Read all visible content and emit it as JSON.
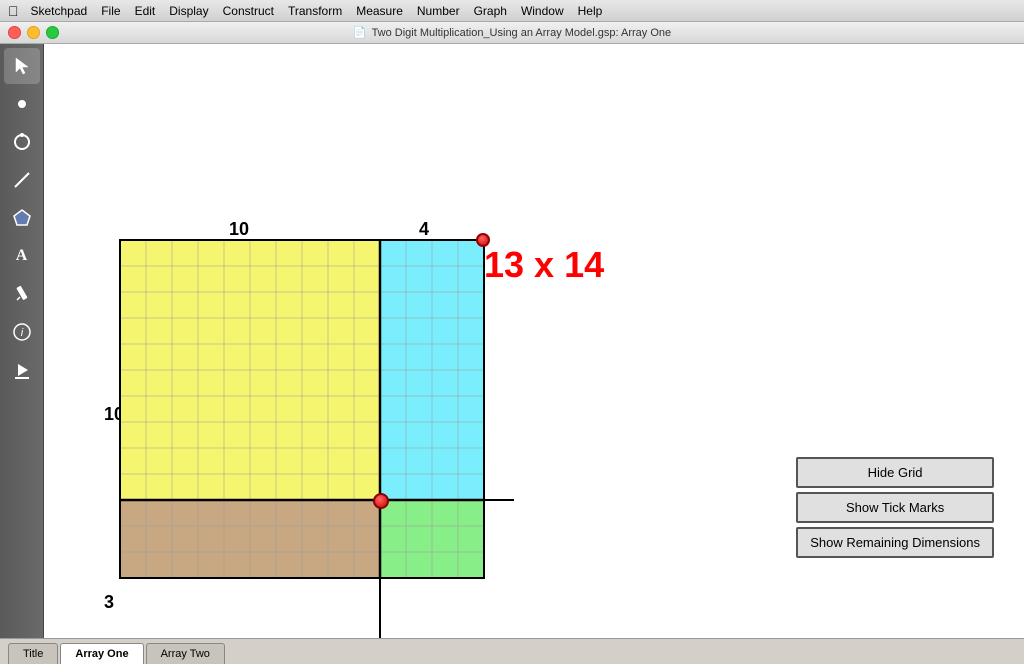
{
  "menubar": {
    "apple": "⌘",
    "items": [
      "Sketchpad",
      "File",
      "Edit",
      "Display",
      "Construct",
      "Transform",
      "Measure",
      "Number",
      "Graph",
      "Window",
      "Help"
    ]
  },
  "titlebar": {
    "title": "Two Digit Multiplication_Using an Array Model.gsp: Array One"
  },
  "toolbar": {
    "tools": [
      {
        "name": "select",
        "icon": "↖",
        "active": true
      },
      {
        "name": "point",
        "icon": "•"
      },
      {
        "name": "circle",
        "icon": "○"
      },
      {
        "name": "line",
        "icon": "╱"
      },
      {
        "name": "polygon",
        "icon": "⬠"
      },
      {
        "name": "text",
        "icon": "A"
      },
      {
        "name": "marker",
        "icon": "✏"
      },
      {
        "name": "info",
        "icon": "ℹ"
      },
      {
        "name": "animation",
        "icon": "▶"
      }
    ]
  },
  "canvas": {
    "equation": "13 x 14",
    "label_10_top": "10",
    "label_4_top": "4",
    "label_10_left": "10",
    "label_3_left": "3",
    "grid": {
      "yellow_cols": 10,
      "yellow_rows": 10,
      "cyan_cols": 4,
      "cyan_rows": 10,
      "tan_cols": 10,
      "tan_rows": 3,
      "green_cols": 4,
      "green_rows": 3,
      "cell_size": 26
    }
  },
  "buttons": {
    "hide_grid": "Hide Grid",
    "show_tick_marks": "Show Tick Marks",
    "show_remaining_dimensions": "Show Remaining Dimensions"
  },
  "tabs": [
    {
      "label": "Title",
      "active": false
    },
    {
      "label": "Array One",
      "active": true
    },
    {
      "label": "Array Two",
      "active": false
    }
  ],
  "colors": {
    "yellow": "#f5f570",
    "cyan": "#7aeeff",
    "tan": "#c8a882",
    "green": "#88f088",
    "equation_red": "#ff0000",
    "grid_line": "#aaa",
    "border": "#000"
  }
}
